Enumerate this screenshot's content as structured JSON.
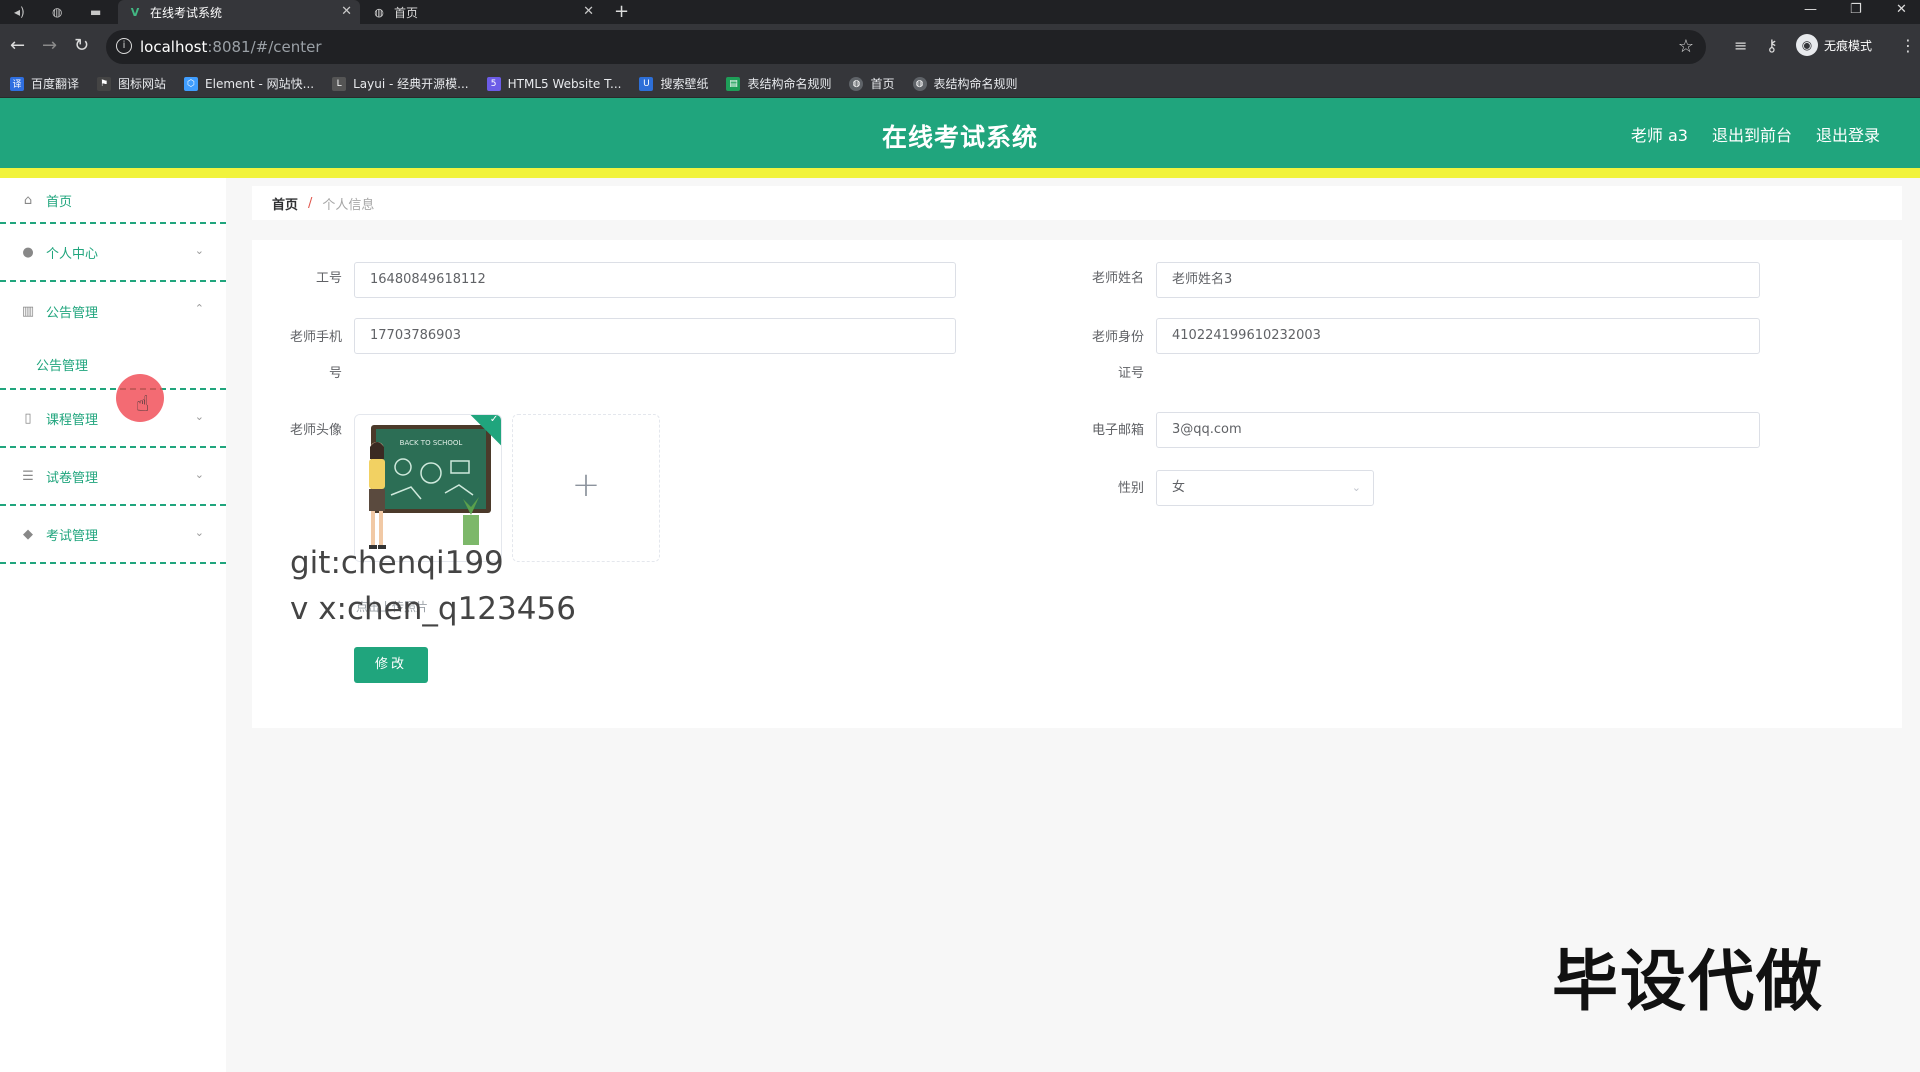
{
  "browser": {
    "tabs": [
      {
        "title": "在线考试系统",
        "favicon": "vue-logo-icon",
        "active": true
      },
      {
        "title": "首页",
        "favicon": "globe-icon",
        "active": false
      }
    ],
    "url_host": "localhost",
    "url_rest": ":8081/#/center",
    "profile_label": "无痕模式",
    "bookmarks": [
      {
        "label": "百度翻译",
        "icon": "translate-icon",
        "color": "#2f6fe0"
      },
      {
        "label": "图标网站",
        "icon": "flag-icon",
        "color": "#444444"
      },
      {
        "label": "Element - 网站快...",
        "icon": "element-icon",
        "color": "#409eff"
      },
      {
        "label": "Layui - 经典开源模...",
        "icon": "layui-icon",
        "color": "#555555"
      },
      {
        "label": "HTML5 Website T...",
        "icon": "html5-icon",
        "color": "#6c5ce7"
      },
      {
        "label": "搜索壁纸",
        "icon": "wallpaper-icon",
        "color": "#2d6fd8"
      },
      {
        "label": "表结构命名规则",
        "icon": "sheet-icon",
        "color": "#1e9e58"
      },
      {
        "label": "首页",
        "icon": "globe-icon",
        "color": "#5f6368"
      },
      {
        "label": "表结构命名规则",
        "icon": "globe-icon",
        "color": "#5f6368"
      }
    ]
  },
  "header": {
    "title": "在线考试系统",
    "user_label": "老师 a3",
    "front_link": "退出到前台",
    "logout_link": "退出登录",
    "brand_color": "#20a57d",
    "strip_color": "#f1f33c"
  },
  "sidebar": {
    "items": [
      {
        "label": "首页",
        "icon": "home-icon"
      },
      {
        "label": "个人中心",
        "icon": "user-icon"
      },
      {
        "label": "公告管理",
        "icon": "notice-icon"
      },
      {
        "label": "公告管理",
        "icon": ""
      },
      {
        "label": "课程管理",
        "icon": "course-icon"
      },
      {
        "label": "试卷管理",
        "icon": "paper-icon"
      },
      {
        "label": "考试管理",
        "icon": "exam-icon"
      }
    ]
  },
  "breadcrumb": {
    "home": "首页",
    "separator": "/",
    "current": "个人信息"
  },
  "form": {
    "job_no_label": "工号",
    "job_no_value": "16480849618112",
    "teacher_name_label": "老师姓名",
    "teacher_name_value": "老师姓名3",
    "phone_label_1": "老师手机",
    "phone_label_2": "号",
    "phone_value": "17703786903",
    "id_label_1": "老师身份",
    "id_label_2": "证号",
    "id_value": "410224199610232003",
    "avatar_label": "老师头像",
    "upload_plus": "+",
    "upload_tip": "点击上传照片",
    "email_label": "电子邮箱",
    "email_value": "3@qq.com",
    "gender_label": "性别",
    "gender_value": "女",
    "submit_label": "修改"
  },
  "watermarks": {
    "git": "git:chenqi199",
    "vx": "v x:chen_q123456",
    "big": "毕设代做"
  }
}
